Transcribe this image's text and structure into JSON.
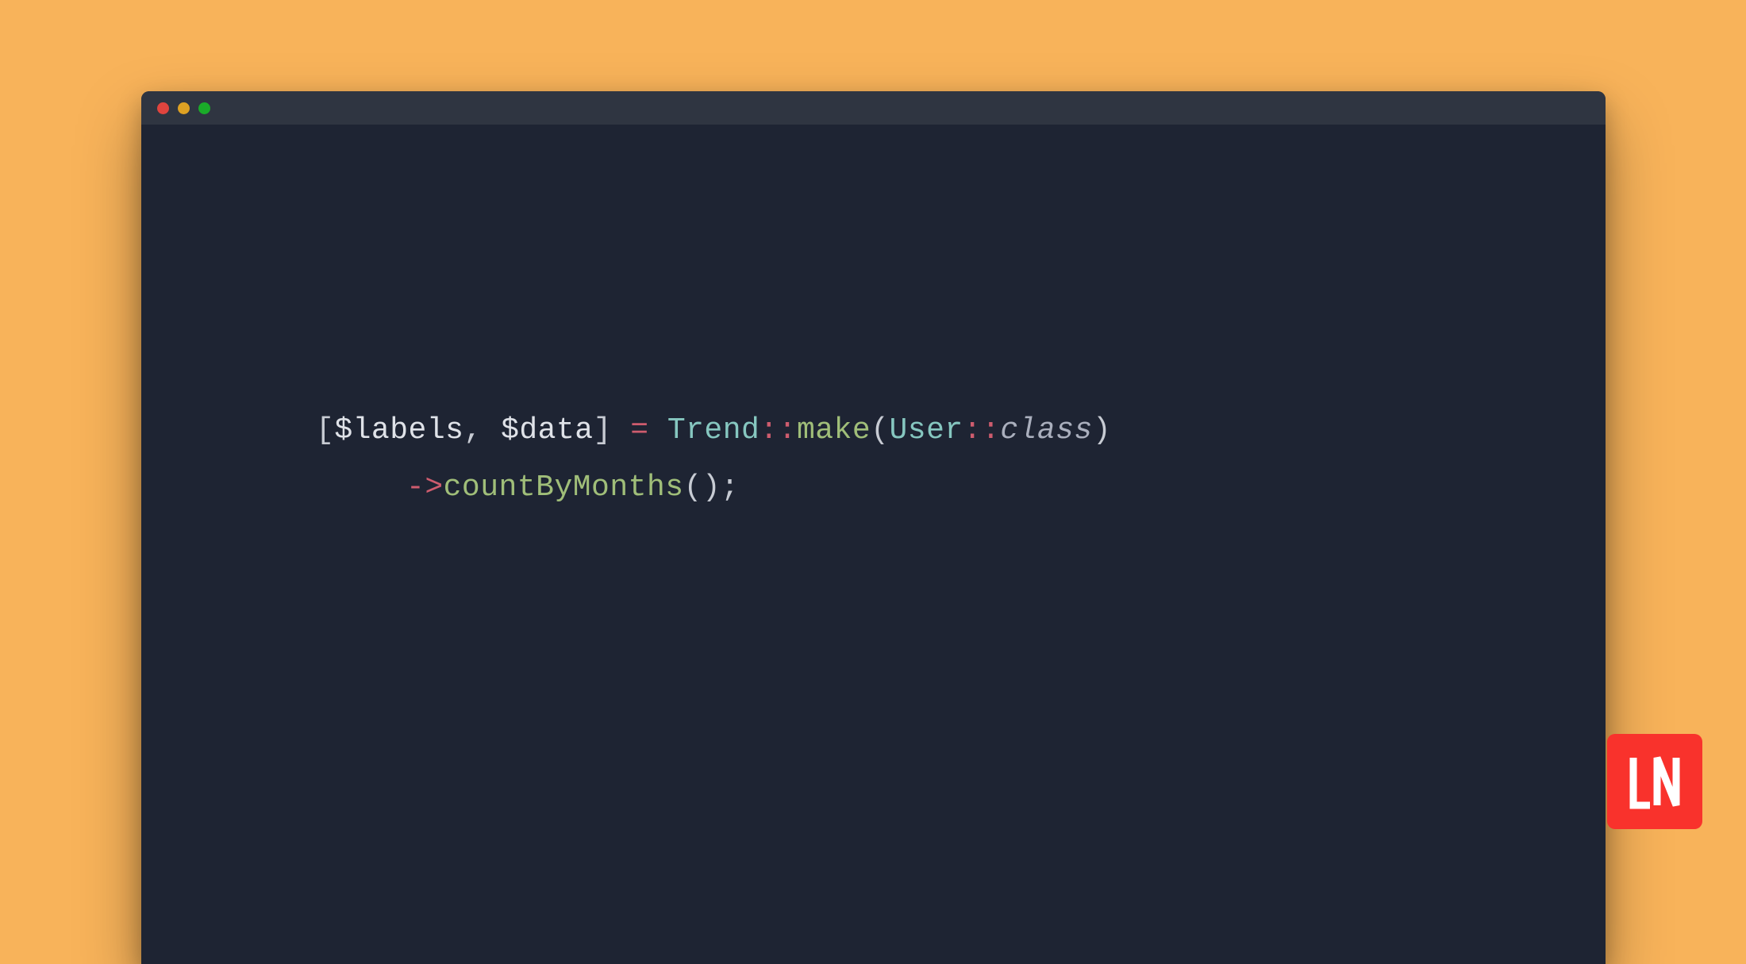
{
  "colors": {
    "page_bg": "#f8b35a",
    "editor_bg": "#1e2433",
    "titlebar_bg": "#2f3541",
    "dot_red": "#e0443e",
    "dot_yellow": "#dea123",
    "dot_green": "#1aab29",
    "logo_bg": "#f9322c"
  },
  "code": {
    "line1": {
      "br1": "[",
      "var1": "$labels",
      "comma": ", ",
      "var2": "$data",
      "br2": "] ",
      "eq": "=",
      "sp1": " ",
      "cls1": "Trend",
      "sc1": "::",
      "m1": "make",
      "p1": "(",
      "cls2": "User",
      "sc2": "::",
      "kw": "class",
      "p2": ")"
    },
    "line2": {
      "arrow": "->",
      "m2": "countByMonths",
      "p3": "();"
    }
  },
  "logo_text": "LN"
}
